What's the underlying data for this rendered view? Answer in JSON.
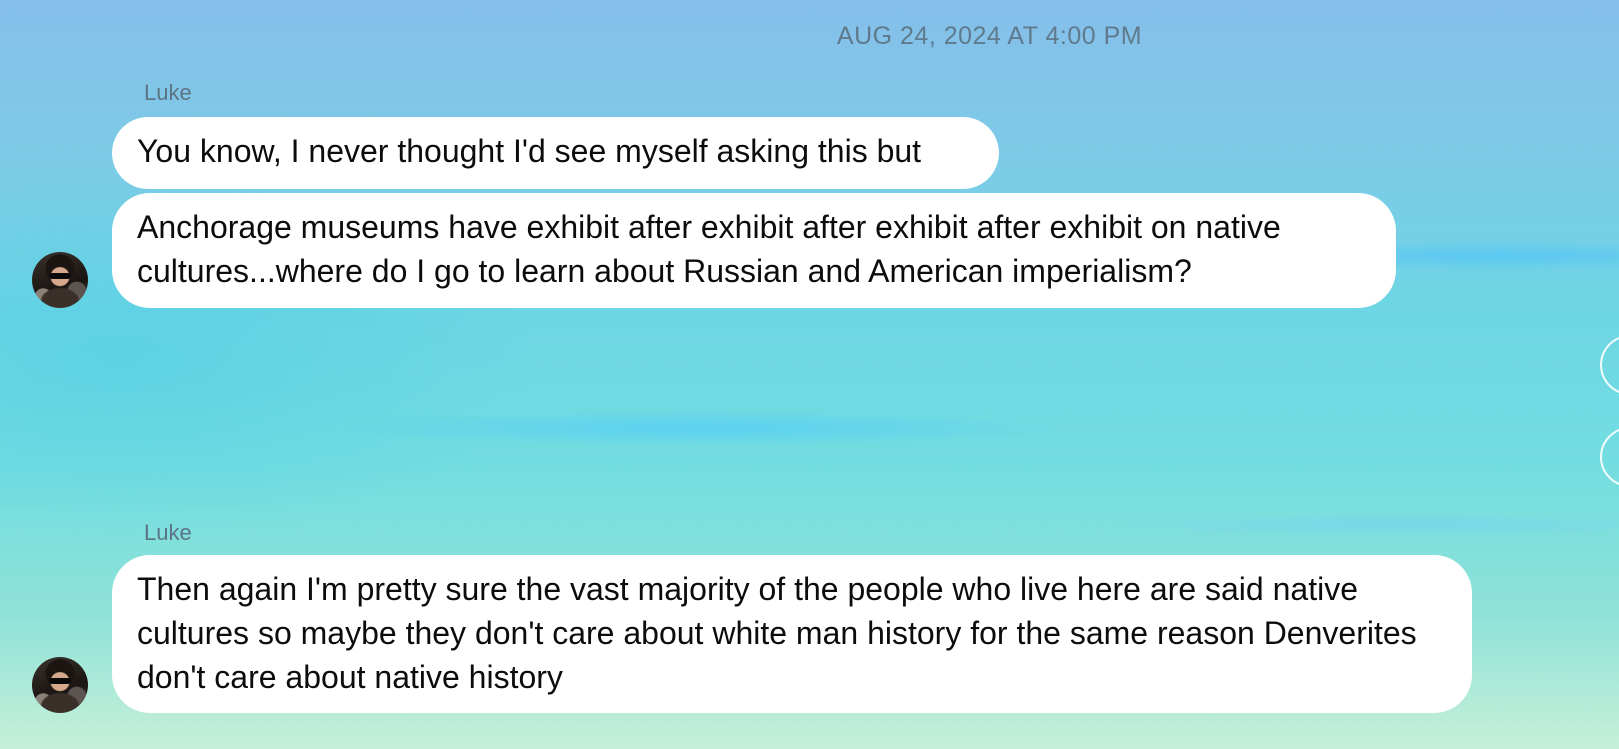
{
  "timestamp": "AUG 24, 2024 AT 4:00 PM",
  "groups": [
    {
      "sender": "Luke",
      "messages": [
        "You know, I never thought I'd see myself asking this but",
        "Anchorage museums have exhibit after exhibit after exhibit after exhibit on native cultures...where do I go to learn about Russian and American imperialism?"
      ]
    },
    {
      "sender": "Luke",
      "messages": [
        "Then again I'm pretty sure the vast majority of the people who live here are said native cultures so maybe they don't care about white man history for the same reason Denverites don't care about native history"
      ]
    }
  ],
  "colors": {
    "bubble": "#ffffff",
    "timestamp_text": "#5f7a8c",
    "sender_text": "#5c7485"
  },
  "icons": [
    "avatar-photo",
    "circle-outline-icon"
  ]
}
